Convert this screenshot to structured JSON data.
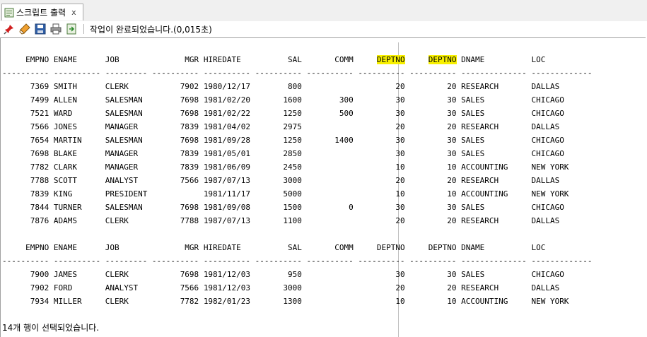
{
  "tab": {
    "label": "스크립트 출력",
    "close": "x"
  },
  "toolbar": {
    "buttons": [
      "pin-icon",
      "eraser-icon",
      "save-icon",
      "print-icon",
      "export-icon"
    ],
    "status": "작업이 완료되었습니다.(0,015초)"
  },
  "columns": [
    "EMPNO",
    "ENAME",
    "JOB",
    "MGR",
    "HIREDATE",
    "SAL",
    "COMM",
    "DEPTNO",
    "DEPTNO",
    "DNAME",
    "LOC"
  ],
  "highlighted_columns": [
    7,
    8
  ],
  "highlight_color": "#f8f000",
  "result_sets": [
    {
      "rows": [
        [
          "7369",
          "SMITH",
          "CLERK",
          "7902",
          "1980/12/17",
          "800",
          "",
          "20",
          "20",
          "RESEARCH",
          "DALLAS"
        ],
        [
          "7499",
          "ALLEN",
          "SALESMAN",
          "7698",
          "1981/02/20",
          "1600",
          "300",
          "30",
          "30",
          "SALES",
          "CHICAGO"
        ],
        [
          "7521",
          "WARD",
          "SALESMAN",
          "7698",
          "1981/02/22",
          "1250",
          "500",
          "30",
          "30",
          "SALES",
          "CHICAGO"
        ],
        [
          "7566",
          "JONES",
          "MANAGER",
          "7839",
          "1981/04/02",
          "2975",
          "",
          "20",
          "20",
          "RESEARCH",
          "DALLAS"
        ],
        [
          "7654",
          "MARTIN",
          "SALESMAN",
          "7698",
          "1981/09/28",
          "1250",
          "1400",
          "30",
          "30",
          "SALES",
          "CHICAGO"
        ],
        [
          "7698",
          "BLAKE",
          "MANAGER",
          "7839",
          "1981/05/01",
          "2850",
          "",
          "30",
          "30",
          "SALES",
          "CHICAGO"
        ],
        [
          "7782",
          "CLARK",
          "MANAGER",
          "7839",
          "1981/06/09",
          "2450",
          "",
          "10",
          "10",
          "ACCOUNTING",
          "NEW YORK"
        ],
        [
          "7788",
          "SCOTT",
          "ANALYST",
          "7566",
          "1987/07/13",
          "3000",
          "",
          "20",
          "20",
          "RESEARCH",
          "DALLAS"
        ],
        [
          "7839",
          "KING",
          "PRESIDENT",
          "",
          "1981/11/17",
          "5000",
          "",
          "10",
          "10",
          "ACCOUNTING",
          "NEW YORK"
        ],
        [
          "7844",
          "TURNER",
          "SALESMAN",
          "7698",
          "1981/09/08",
          "1500",
          "0",
          "30",
          "30",
          "SALES",
          "CHICAGO"
        ],
        [
          "7876",
          "ADAMS",
          "CLERK",
          "7788",
          "1987/07/13",
          "1100",
          "",
          "20",
          "20",
          "RESEARCH",
          "DALLAS"
        ]
      ]
    },
    {
      "rows": [
        [
          "7900",
          "JAMES",
          "CLERK",
          "7698",
          "1981/12/03",
          "950",
          "",
          "30",
          "30",
          "SALES",
          "CHICAGO"
        ],
        [
          "7902",
          "FORD",
          "ANALYST",
          "7566",
          "1981/12/03",
          "3000",
          "",
          "20",
          "20",
          "RESEARCH",
          "DALLAS"
        ],
        [
          "7934",
          "MILLER",
          "CLERK",
          "7782",
          "1982/01/23",
          "1300",
          "",
          "10",
          "10",
          "ACCOUNTING",
          "NEW YORK"
        ]
      ]
    }
  ],
  "message": "14개 행이 선택되었습니다."
}
